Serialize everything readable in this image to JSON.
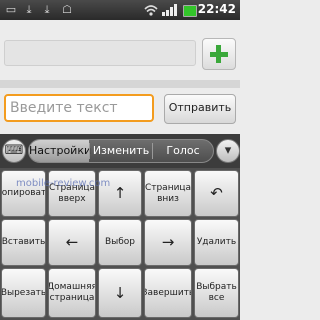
{
  "status_bar": {
    "time": "22:42",
    "icons": [
      "sd-card-icon",
      "download-icon",
      "download-icon",
      "android-icon",
      "wifi-icon",
      "signal-icon",
      "battery-icon"
    ]
  },
  "top": {
    "add_button_icon": "plus-icon"
  },
  "input": {
    "placeholder": "Введите текст",
    "send_label": "Отправить"
  },
  "keyboard": {
    "toolbar": {
      "left_icon": "keyboard-icon",
      "tabs": [
        "Настройки",
        "Изменить",
        "Голос"
      ],
      "active_tab": "Настройки",
      "right_icon": "chevron-down-icon"
    },
    "keys": {
      "copy": "Копировать",
      "page_up": "Страница вверх",
      "up": "↑",
      "page_down": "Страница вниз",
      "undo": "↶",
      "paste": "Вставить",
      "left": "←",
      "select": "Выбор",
      "right": "→",
      "delete": "Удалить",
      "cut": "Вырезать",
      "home": "Домашняя страница",
      "down": "↓",
      "finish": "Завершить",
      "select_all": "Выбрать все"
    }
  },
  "watermark": "mobile-review.com"
}
